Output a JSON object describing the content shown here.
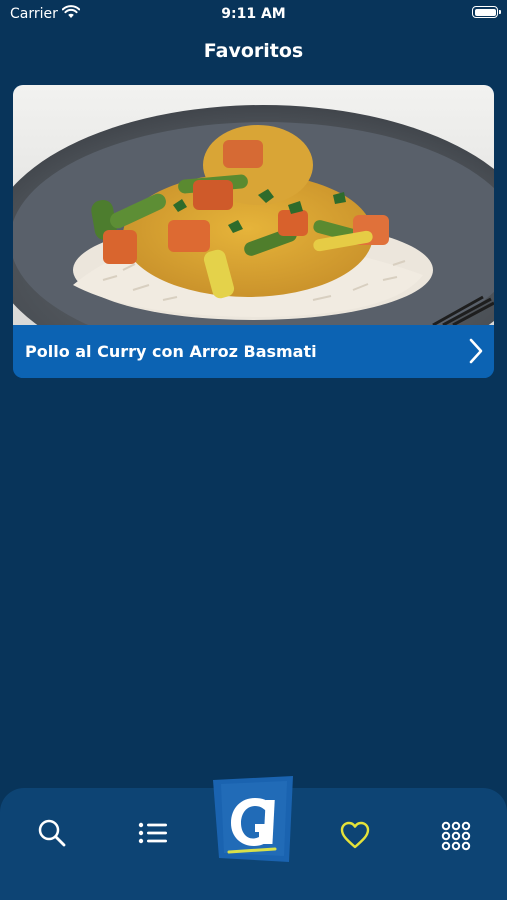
{
  "status_bar": {
    "carrier": "Carrier",
    "time": "9:11 AM"
  },
  "nav": {
    "title": "Favoritos"
  },
  "favorites": [
    {
      "title": "Pollo al Curry con Arroz Basmati",
      "image": "curry-chicken-rice-photo"
    }
  ],
  "tab_bar": {
    "items": [
      {
        "icon": "search-icon",
        "active": false
      },
      {
        "icon": "list-icon",
        "active": false
      },
      {
        "icon": "app-logo",
        "active": false
      },
      {
        "icon": "heart-icon",
        "active": true
      },
      {
        "icon": "grid-icon",
        "active": false
      }
    ],
    "active_color": "#e4e23a",
    "inactive_color": "#ffffff"
  },
  "colors": {
    "background": "#08345a",
    "card_footer": "#0c63b3",
    "tab_bar": "#0d4474"
  }
}
